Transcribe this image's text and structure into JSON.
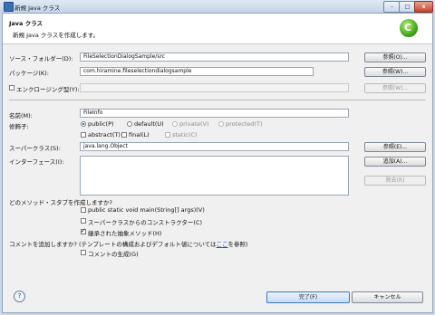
{
  "window": {
    "title": "新規 Java クラス",
    "minimize": "–",
    "maximize": "□",
    "close": "x"
  },
  "header": {
    "title": "Java クラス",
    "message": "新規 Java クラスを作成します。",
    "icon": "eclipse-new-class-icon",
    "icon_glyph": "C"
  },
  "form": {
    "source_folder": {
      "label": "ソース・フォルダー(D):",
      "value": "FileSelectionDialogSample/src",
      "browse": "参照(O)..."
    },
    "package": {
      "label": "パッケージ(K):",
      "value": "com.hiramine.fileselectiondialogsample",
      "browse": "参照(W)..."
    },
    "enclosing": {
      "label": "エンクロージング型(Y):",
      "value": "",
      "browse": "参照(W)..."
    },
    "name": {
      "label": "名前(M):",
      "value": "FileInfo"
    },
    "modifiers": {
      "label": "修飾子:",
      "public": "public(P)",
      "default": "default(U)",
      "private": "private(V)",
      "protected": "protected(T)",
      "abstract": "abstract(T)",
      "final": "final(L)",
      "static": "static(C)"
    },
    "superclass": {
      "label": "スーパークラス(S):",
      "value": "java.lang.Object",
      "browse": "参照(E)..."
    },
    "interfaces": {
      "label": "インターフェース(I):",
      "add": "追加(A)...",
      "remove": "除去(R)"
    },
    "stubs": {
      "question": "どのメソッド・スタブを作成しますか?",
      "main": "public static void main(String[] args)(V)",
      "constructors": "スーパークラスからのコンストラクター(C)",
      "inherited": "継承された抽象メソッド(H)"
    },
    "comments": {
      "question_prefix": "コメントを追加しますか? (テンプレートの構成およびデフォルト値については",
      "link": "ここ",
      "question_suffix": "を参照)",
      "generate": "コメントの生成(G)"
    }
  },
  "footer": {
    "help": "?",
    "finish": "完了(F)",
    "cancel": "キャンセル"
  },
  "colors": {
    "accent": "#3b79c2",
    "link": "#1f54c5",
    "titlebar": "#c3d4e8"
  }
}
